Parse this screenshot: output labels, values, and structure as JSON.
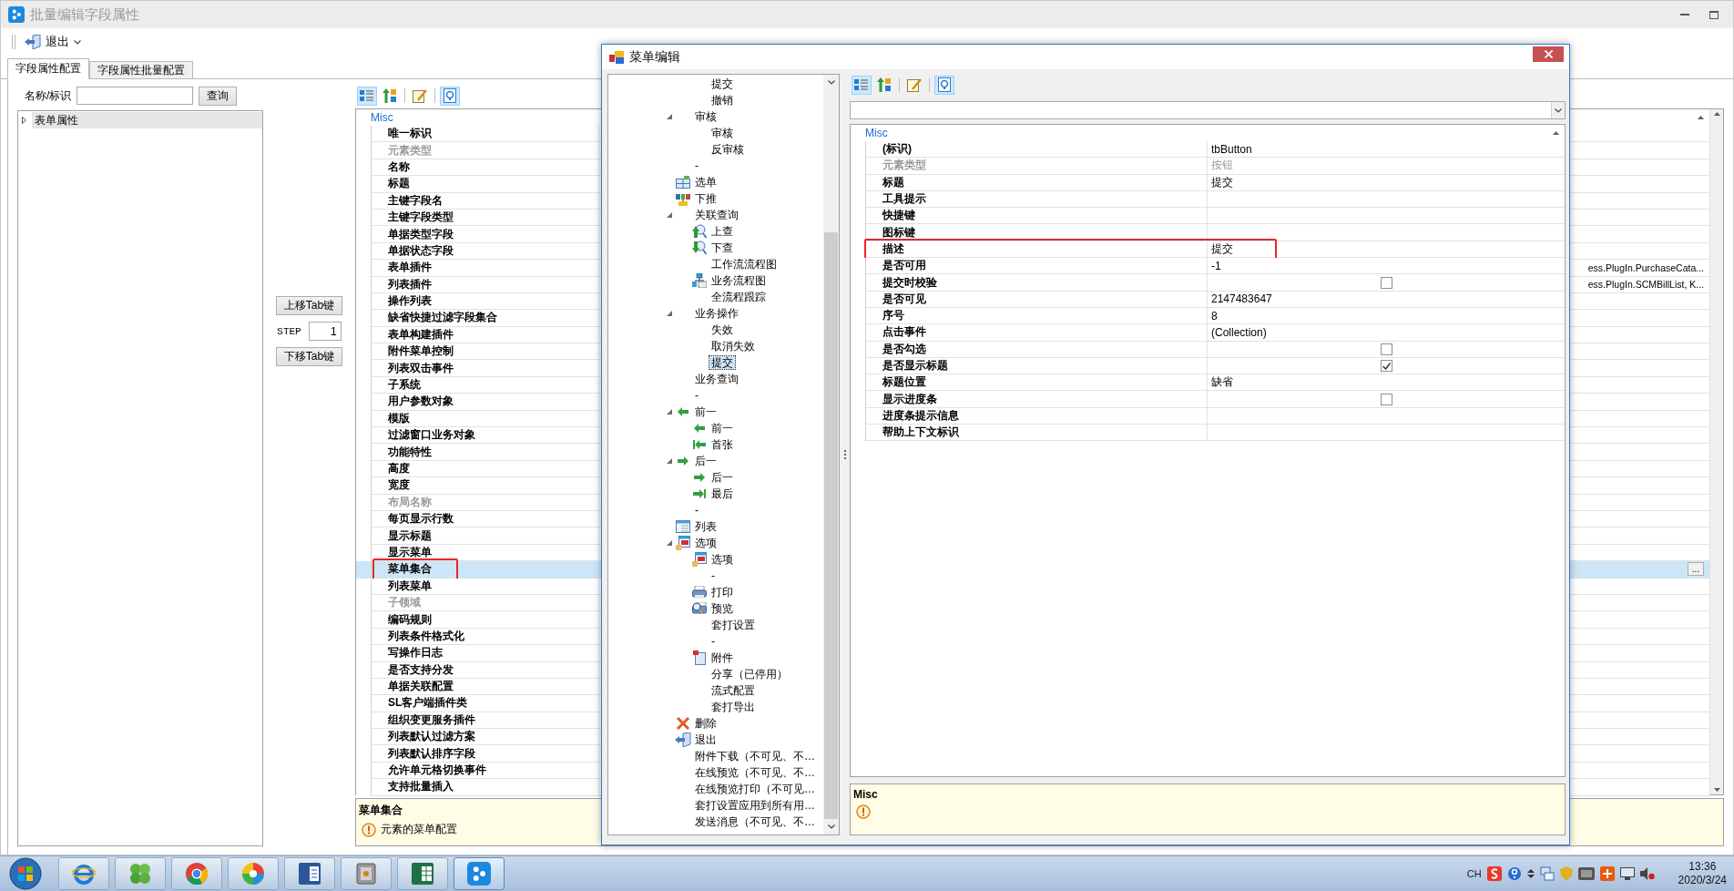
{
  "window": {
    "title": "批量编辑字段属性"
  },
  "toolbar": {
    "exit": "退出"
  },
  "tabs": [
    {
      "label": "字段属性配置",
      "selected": true
    },
    {
      "label": "字段属性批量配置",
      "selected": false
    }
  ],
  "search": {
    "label": "名称/标识",
    "button": "查询"
  },
  "form_tree": {
    "items": [
      {
        "label": "表单属性",
        "expanded": false,
        "selected": true
      }
    ]
  },
  "tab_order": {
    "up": "上移Tab键",
    "step_label": "STEP",
    "step": "1",
    "down": "下移Tab键"
  },
  "property_grid": {
    "toolbar": [
      {
        "kind": "categorized",
        "selected": true
      },
      {
        "kind": "alphabetical",
        "selected": false
      },
      {
        "kind": "pages",
        "selected": false
      },
      {
        "kind": "description",
        "selected": true
      }
    ],
    "category": "Misc",
    "rows": [
      {
        "name": "唯一标识",
        "disabled": false,
        "selected": false,
        "marked": false
      },
      {
        "name": "元素类型",
        "disabled": true,
        "selected": false,
        "marked": false
      },
      {
        "name": "名称",
        "disabled": false,
        "selected": false,
        "marked": false
      },
      {
        "name": "标题",
        "disabled": false,
        "selected": false,
        "marked": false
      },
      {
        "name": "主键字段名",
        "disabled": false,
        "selected": false,
        "marked": false
      },
      {
        "name": "主键字段类型",
        "disabled": false,
        "selected": false,
        "marked": false
      },
      {
        "name": "单据类型字段",
        "disabled": false,
        "selected": false,
        "marked": false
      },
      {
        "name": "单据状态字段",
        "disabled": false,
        "selected": false,
        "marked": false
      },
      {
        "name": "表单插件",
        "value": "ess.PlugIn.PurchaseCata...",
        "disabled": false,
        "selected": false,
        "marked": false
      },
      {
        "name": "列表插件",
        "value": "ess.PlugIn.SCMBillList, K...",
        "disabled": false,
        "selected": false,
        "marked": false
      },
      {
        "name": "操作列表",
        "disabled": false,
        "selected": false,
        "marked": false
      },
      {
        "name": "缺省快捷过滤字段集合",
        "disabled": false,
        "selected": false,
        "marked": false
      },
      {
        "name": "表单构建插件",
        "disabled": false,
        "selected": false,
        "marked": false
      },
      {
        "name": "附件菜单控制",
        "disabled": false,
        "selected": false,
        "marked": false
      },
      {
        "name": "列表双击事件",
        "disabled": false,
        "selected": false,
        "marked": false
      },
      {
        "name": "子系统",
        "disabled": false,
        "selected": false,
        "marked": false
      },
      {
        "name": "用户参数对象",
        "disabled": false,
        "selected": false,
        "marked": false
      },
      {
        "name": "模版",
        "disabled": false,
        "selected": false,
        "marked": false
      },
      {
        "name": "过滤窗口业务对象",
        "disabled": false,
        "selected": false,
        "marked": false
      },
      {
        "name": "功能特性",
        "disabled": false,
        "selected": false,
        "marked": false
      },
      {
        "name": "高度",
        "disabled": false,
        "selected": false,
        "marked": false
      },
      {
        "name": "宽度",
        "disabled": false,
        "selected": false,
        "marked": false
      },
      {
        "name": "布局名称",
        "disabled": true,
        "selected": false,
        "marked": false
      },
      {
        "name": "每页显示行数",
        "disabled": false,
        "selected": false,
        "marked": false
      },
      {
        "name": "显示标题",
        "disabled": false,
        "selected": false,
        "marked": false
      },
      {
        "name": "显示菜单",
        "disabled": false,
        "selected": false,
        "marked": false
      },
      {
        "name": "菜单集合",
        "button": "...",
        "disabled": false,
        "selected": true,
        "marked": true
      },
      {
        "name": "列表菜单",
        "disabled": false,
        "selected": false,
        "marked": false
      },
      {
        "name": "子领域",
        "disabled": true,
        "selected": false,
        "marked": false
      },
      {
        "name": "编码规则",
        "disabled": false,
        "selected": false,
        "marked": false
      },
      {
        "name": "列表条件格式化",
        "disabled": false,
        "selected": false,
        "marked": false
      },
      {
        "name": "写操作日志",
        "disabled": false,
        "selected": false,
        "marked": false
      },
      {
        "name": "是否支持分发",
        "disabled": false,
        "selected": false,
        "marked": false
      },
      {
        "name": "单据关联配置",
        "disabled": false,
        "selected": false,
        "marked": false
      },
      {
        "name": "SL客户端插件类",
        "disabled": false,
        "selected": false,
        "marked": false
      },
      {
        "name": "组织变更服务插件",
        "disabled": false,
        "selected": false,
        "marked": false
      },
      {
        "name": "列表默认过滤方案",
        "disabled": false,
        "selected": false,
        "marked": false
      },
      {
        "name": "列表默认排序字段",
        "disabled": false,
        "selected": false,
        "marked": false
      },
      {
        "name": "允许单元格切换事件",
        "disabled": false,
        "selected": false,
        "marked": false
      },
      {
        "name": "支持批量插入",
        "disabled": false,
        "selected": false,
        "marked": false
      }
    ],
    "description": {
      "title": "菜单集合",
      "text": "元素的菜单配置"
    }
  },
  "dialog": {
    "title": "菜单编辑",
    "tree": {
      "items": [
        {
          "kind": "hidden",
          "children": [
            {
              "label": "提交",
              "kind": "plain",
              "selected": false
            },
            {
              "label": "撤销",
              "kind": "plain",
              "selected": false
            }
          ]
        },
        {
          "label": "审核",
          "kind": "plain",
          "selected": false,
          "expanded": true,
          "children": [
            {
              "label": "审核",
              "kind": "plain",
              "selected": false
            },
            {
              "label": "反审核",
              "kind": "plain",
              "selected": false
            }
          ]
        },
        {
          "label": "-",
          "kind": "plain",
          "selected": false
        },
        {
          "label": "选单",
          "kind": "table",
          "selected": false
        },
        {
          "label": "下推",
          "kind": "diagram",
          "selected": false
        },
        {
          "label": "关联查询",
          "kind": "plain",
          "selected": false,
          "expanded": true,
          "children": [
            {
              "label": "上查",
              "kind": "search-up",
              "selected": false
            },
            {
              "label": "下查",
              "kind": "search-down",
              "selected": false
            },
            {
              "label": "工作流流程图",
              "kind": "plain",
              "selected": false
            },
            {
              "label": "业务流程图",
              "kind": "hierarchy",
              "selected": false
            },
            {
              "label": "全流程跟踪",
              "kind": "plain",
              "selected": false
            }
          ]
        },
        {
          "label": "业务操作",
          "kind": "plain",
          "selected": false,
          "expanded": true,
          "children": [
            {
              "label": "失效",
              "kind": "plain",
              "selected": false
            },
            {
              "label": "取消失效",
              "kind": "plain",
              "selected": false
            },
            {
              "label": "提交",
              "kind": "plain",
              "selected": true
            }
          ]
        },
        {
          "label": "业务查询",
          "kind": "plain",
          "selected": false
        },
        {
          "label": "-",
          "kind": "plain",
          "selected": false
        },
        {
          "label": "前一",
          "kind": "arrow-left",
          "selected": false,
          "expanded": true,
          "children": [
            {
              "label": "前一",
              "kind": "arrow-left",
              "selected": false
            },
            {
              "label": "首张",
              "kind": "arrow-first",
              "selected": false
            }
          ]
        },
        {
          "label": "后一",
          "kind": "arrow-right",
          "selected": false,
          "expanded": true,
          "children": [
            {
              "label": "后一",
              "kind": "arrow-right",
              "selected": false
            },
            {
              "label": "最后",
              "kind": "arrow-last",
              "selected": false
            }
          ]
        },
        {
          "label": "-",
          "kind": "plain",
          "selected": false
        },
        {
          "label": "列表",
          "kind": "list",
          "selected": false
        },
        {
          "label": "选项",
          "kind": "calendar",
          "selected": false,
          "expanded": true,
          "children": [
            {
              "label": "选项",
              "kind": "calendar",
              "selected": false
            },
            {
              "label": "-",
              "kind": "plain",
              "selected": false
            },
            {
              "label": "打印",
              "kind": "printer",
              "selected": false
            },
            {
              "label": "预览",
              "kind": "preview",
              "selected": false
            },
            {
              "label": "套打设置",
              "kind": "plain",
              "selected": false
            },
            {
              "label": "-",
              "kind": "plain",
              "selected": false
            },
            {
              "label": "附件",
              "kind": "document",
              "selected": false
            },
            {
              "label": "分享（已停用）",
              "kind": "plain",
              "selected": false
            },
            {
              "label": "流式配置",
              "kind": "plain",
              "selected": false
            },
            {
              "label": "套打导出",
              "kind": "plain",
              "selected": false
            }
          ]
        },
        {
          "label": "删除",
          "kind": "delete",
          "selected": false
        },
        {
          "label": "退出",
          "kind": "exit",
          "selected": false
        },
        {
          "label": "附件下载（不可见、不…",
          "kind": "plain",
          "selected": false
        },
        {
          "label": "在线预览（不可见、不…",
          "kind": "plain",
          "selected": false
        },
        {
          "label": "在线预览打印（不可见…",
          "kind": "plain",
          "selected": false
        },
        {
          "label": "套打设置应用到所有用…",
          "kind": "plain",
          "selected": false
        },
        {
          "label": "发送消息（不可见、不…",
          "kind": "plain",
          "selected": false
        }
      ]
    },
    "toolbar": [
      {
        "kind": "categorized",
        "selected": true
      },
      {
        "kind": "alphabetical",
        "selected": false
      },
      {
        "kind": "pages",
        "selected": false
      },
      {
        "kind": "description",
        "selected": true
      }
    ],
    "grid": {
      "category": "Misc",
      "rows": [
        {
          "name": "(标识)",
          "kind": "text",
          "value": "tbButton",
          "disabled": false,
          "marked": false
        },
        {
          "name": "元素类型",
          "kind": "text",
          "value": "按钮",
          "disabled": true,
          "marked": false
        },
        {
          "name": "标题",
          "kind": "text",
          "value": "提交",
          "disabled": false,
          "marked": false
        },
        {
          "name": "工具提示",
          "kind": "text",
          "disabled": false,
          "marked": false
        },
        {
          "name": "快捷键",
          "kind": "text",
          "disabled": false,
          "marked": false
        },
        {
          "name": "图标键",
          "kind": "text",
          "disabled": false,
          "marked": false
        },
        {
          "name": "描述",
          "kind": "text",
          "value": "提交",
          "disabled": false,
          "marked": true
        },
        {
          "name": "是否可用",
          "kind": "text",
          "value": "-1",
          "disabled": false,
          "marked": false
        },
        {
          "name": "提交时校验",
          "kind": "checkbox",
          "checked": false,
          "disabled": false,
          "marked": false
        },
        {
          "name": "是否可见",
          "kind": "text",
          "value": "2147483647",
          "disabled": false,
          "marked": false
        },
        {
          "name": "序号",
          "kind": "text",
          "value": "8",
          "disabled": false,
          "marked": false
        },
        {
          "name": "点击事件",
          "kind": "text",
          "value": "(Collection)",
          "disabled": false,
          "marked": false
        },
        {
          "name": "是否勾选",
          "kind": "checkbox",
          "checked": false,
          "disabled": false,
          "marked": false
        },
        {
          "name": "是否显示标题",
          "kind": "checkbox",
          "checked": true,
          "disabled": false,
          "marked": false
        },
        {
          "name": "标题位置",
          "kind": "text",
          "value": "缺省",
          "disabled": false,
          "marked": false
        },
        {
          "name": "显示进度条",
          "kind": "checkbox",
          "checked": false,
          "disabled": false,
          "marked": false
        },
        {
          "name": "进度条提示信息",
          "kind": "text",
          "disabled": false,
          "marked": false
        },
        {
          "name": "帮助上下文标识",
          "kind": "text",
          "disabled": false,
          "marked": false
        }
      ]
    },
    "description": {
      "title": "Misc"
    }
  },
  "taskbar": {
    "apps": [
      {
        "kind": "browser-e",
        "selected": false
      },
      {
        "kind": "clover",
        "selected": false
      },
      {
        "kind": "chrome",
        "selected": false
      },
      {
        "kind": "pinwheel",
        "selected": false
      },
      {
        "kind": "word",
        "selected": false
      },
      {
        "kind": "safe",
        "selected": false
      },
      {
        "kind": "excel",
        "selected": false
      },
      {
        "kind": "dots",
        "selected": true
      }
    ],
    "tray": {
      "language": "CH",
      "time": "13:36",
      "date": "2020/3/24"
    }
  }
}
